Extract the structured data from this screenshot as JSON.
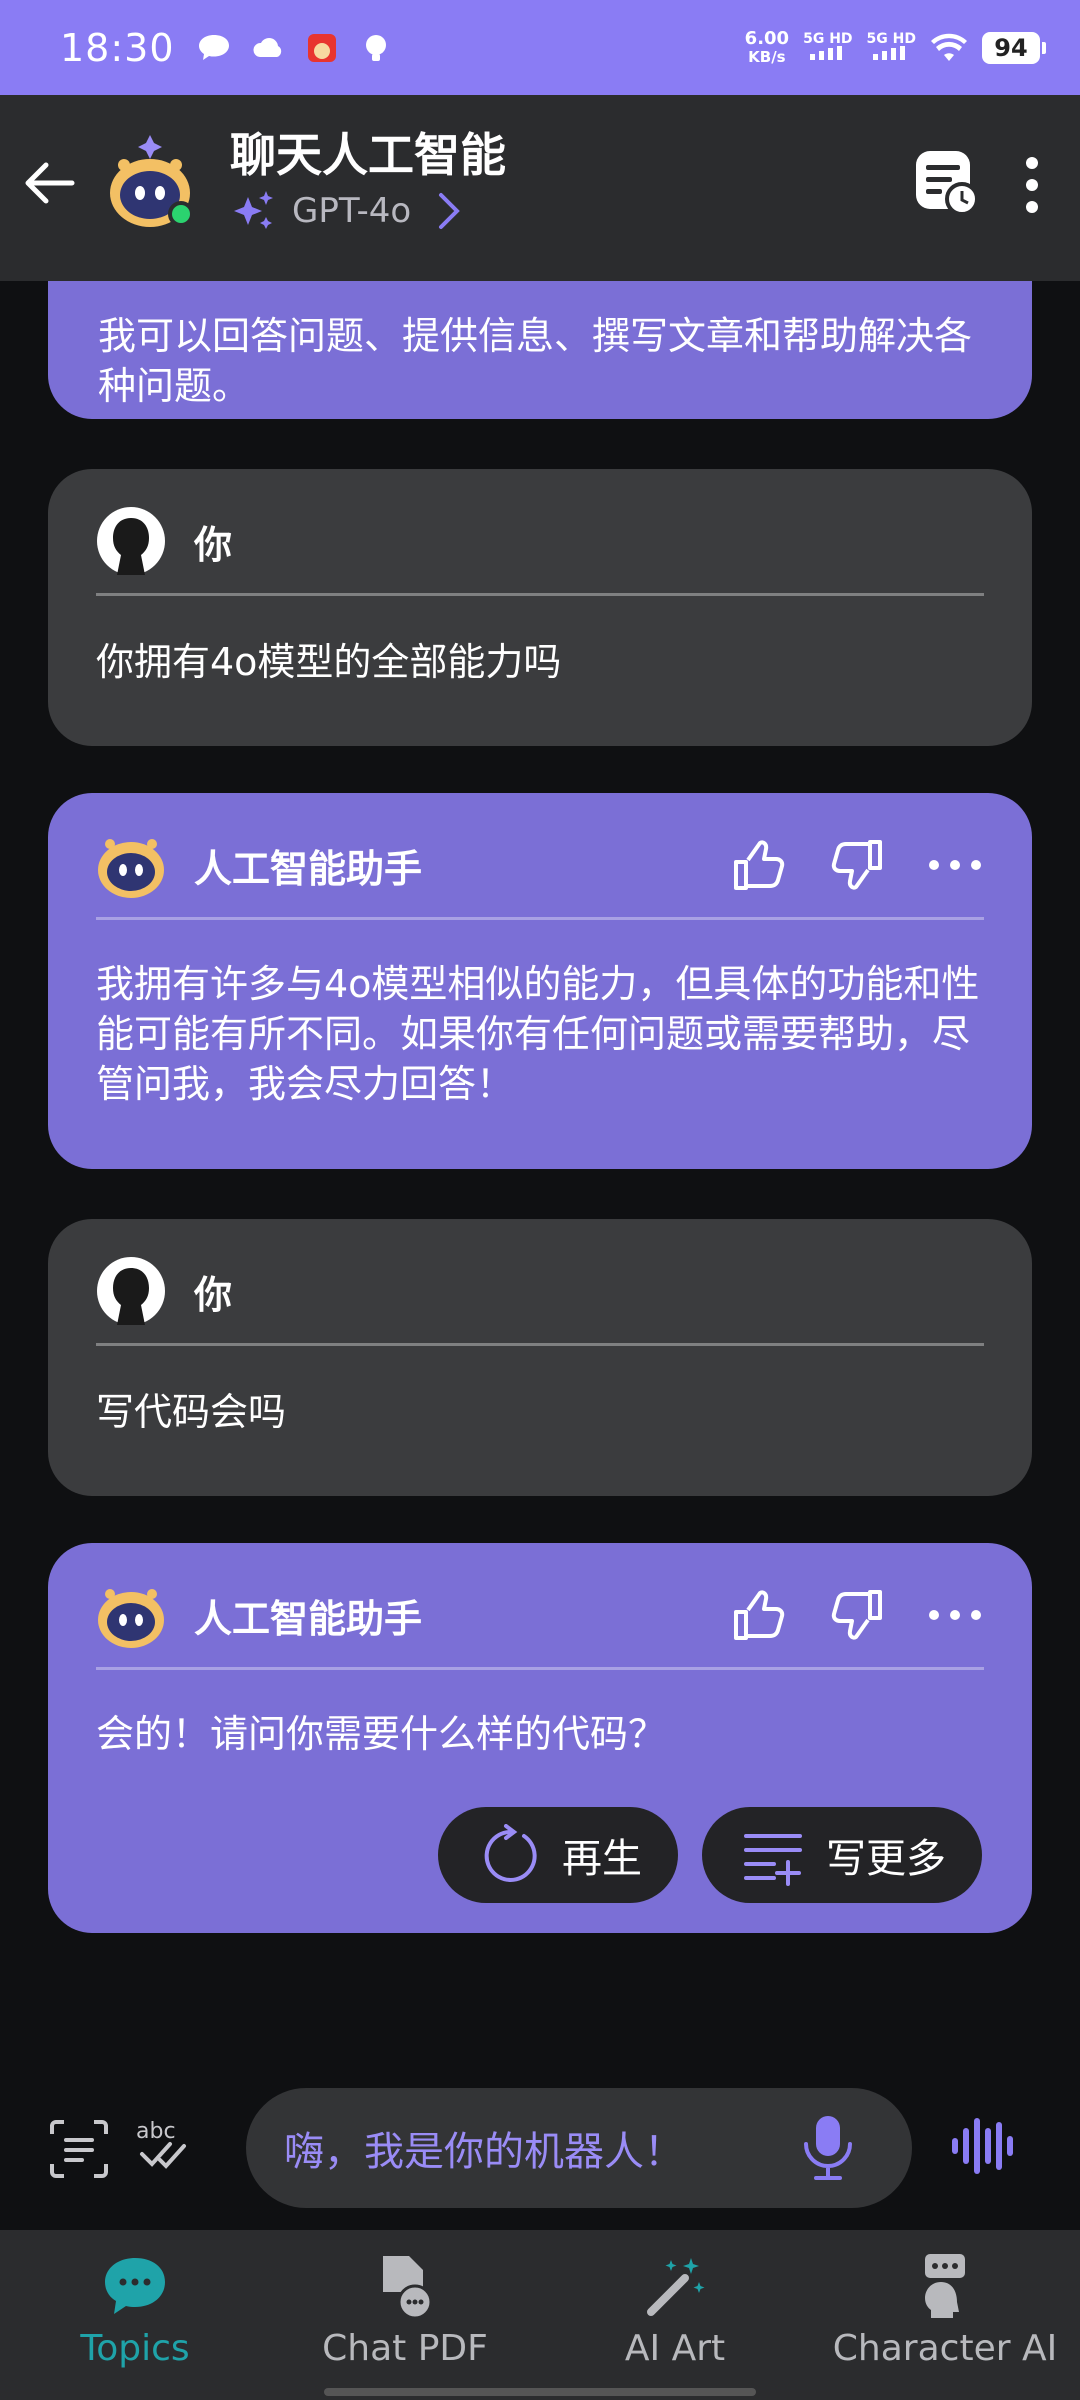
{
  "status": {
    "time": "18:30",
    "netspeed_value": "6.00",
    "netspeed_unit": "KB/s",
    "sim1": "5G HD",
    "sim2": "5G HD",
    "battery": "94"
  },
  "header": {
    "title": "聊天人工智能",
    "model": "GPT-4o"
  },
  "chat": {
    "partial_ai_text": "我可以回答问题、提供信息、撰写文章和帮助解决各种问题。",
    "messages": [
      {
        "role": "user",
        "name": "你",
        "text": "你拥有4o模型的全部能力吗"
      },
      {
        "role": "ai",
        "name": "人工智能助手",
        "text": "我拥有许多与4o模型相似的能力，但具体的功能和性能可能有所不同。如果你有任何问题或需要帮助，尽管问我，我会尽力回答！"
      },
      {
        "role": "user",
        "name": "你",
        "text": "写代码会吗"
      },
      {
        "role": "ai",
        "name": "人工智能助手",
        "text": "会的！请问你需要什么样的代码？"
      }
    ],
    "regenerate_label": "再生",
    "write_more_label": "写更多"
  },
  "input": {
    "placeholder": "嗨，我是你的机器人！"
  },
  "nav": {
    "items": [
      {
        "label": "Topics",
        "icon": "chat-bubble-icon",
        "active": true
      },
      {
        "label": "Chat PDF",
        "icon": "pdf-chat-icon",
        "active": false
      },
      {
        "label": "AI Art",
        "icon": "magic-wand-icon",
        "active": false
      },
      {
        "label": "Character AI",
        "icon": "character-icon",
        "active": false
      }
    ]
  },
  "colors": {
    "accent": "#8a7cf4",
    "ai_bubble": "#7b6fd6",
    "user_bubble": "#3b3c3e",
    "active_nav": "#1fa3a9"
  }
}
